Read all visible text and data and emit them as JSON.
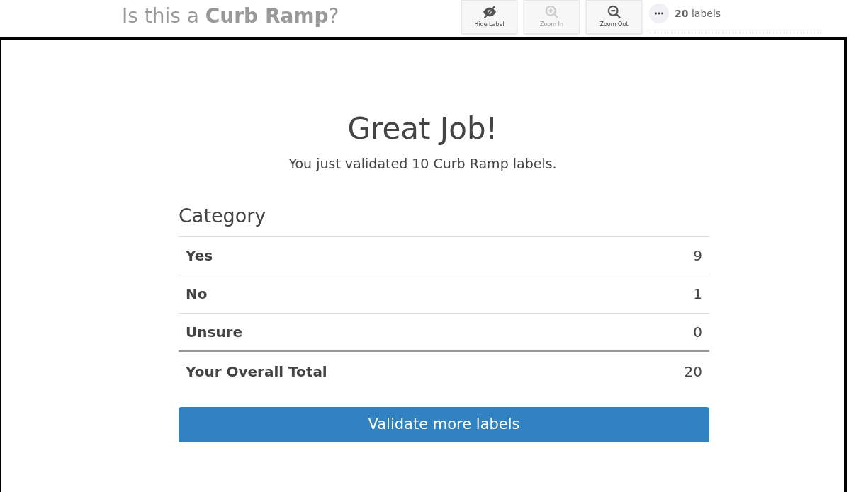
{
  "header": {
    "title": "Is this a **Curb Ramp**?",
    "tools": [
      {
        "kind": "hide",
        "label": "Hide Label",
        "disabled": false
      },
      {
        "kind": "zoom-in",
        "label": "Zoom In",
        "disabled": true
      },
      {
        "kind": "zoom-out",
        "label": "Zoom Out",
        "disabled": false
      }
    ],
    "label_count": "**20** labels"
  },
  "modal": {
    "title": "Great Job!",
    "subtitle": "You just validated 10 Curb Ramp labels.",
    "table": {
      "heading": "Category",
      "rows": [
        {
          "label": "Yes",
          "value": "9"
        },
        {
          "label": "No",
          "value": "1"
        },
        {
          "label": "Unsure",
          "value": "0"
        }
      ],
      "total": {
        "label": "Your Overall Total",
        "value": "20"
      }
    },
    "button": "Validate more labels"
  }
}
